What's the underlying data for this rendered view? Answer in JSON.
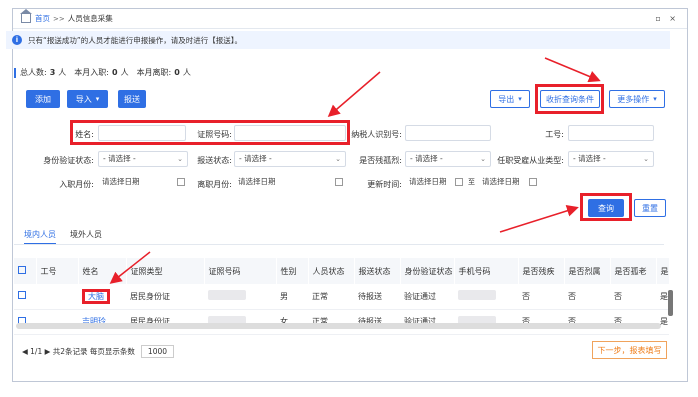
{
  "titlebar": {
    "home": "首页",
    "sep": ">>",
    "current": "人员信息采集",
    "controls": "▫ ×"
  },
  "notice": {
    "icon": "i",
    "text": "只有“报送成功”的人员才能进行申报操作，请及时进行【报送】。"
  },
  "stats": {
    "total_label": "总人数:",
    "total": "3",
    "unit1": "人",
    "hired_label": "本月入职:",
    "hired": "0",
    "unit2": "人",
    "left_label": "本月离职:",
    "left": "0",
    "unit3": "人"
  },
  "toolbar": {
    "add": "添加",
    "import": "导入",
    "report": "报送",
    "export": "导出",
    "collapse": "收折查询条件",
    "more": "更多操作"
  },
  "filters": {
    "name_label": "姓名:",
    "name_value": "",
    "idno_label": "证照号码:",
    "idno_value": "",
    "taxid_label": "纳税人识别号:",
    "taxid_value": "",
    "empno_label": "工号:",
    "empno_value": "",
    "idverify_label": "身份验证状态:",
    "idverify_value": "- 请选择 -",
    "report_label": "报送状态:",
    "report_value": "- 请选择 -",
    "disabled_label": "是否残孤烈:",
    "disabled_value": "- 请选择 -",
    "industry_label": "任职受雇从业类型:",
    "industry_value": "- 请选择 -",
    "entry_label": "入职月份:",
    "entry_value": "请选择日期",
    "leave_label": "离职月份:",
    "leave_value": "请选择日期",
    "update_label": "更新时间:",
    "update_from": "请选择日期",
    "update_to_sep": "至",
    "update_to": "请选择日期"
  },
  "actions": {
    "query": "查询",
    "reset": "重置"
  },
  "tabs": [
    "境内人员",
    "境外人员"
  ],
  "table": {
    "headers": [
      "工号",
      "姓名",
      "证照类型",
      "证照号码",
      "性别",
      "人员状态",
      "报送状态",
      "身份验证状态",
      "手机号码",
      "是否残疾",
      "是否烈属",
      "是否孤老",
      "是"
    ],
    "rows": [
      {
        "id": "",
        "name": "大脑",
        "idtype": "居民身份证",
        "gender": "男",
        "status": "正常",
        "report": "待报送",
        "verify": "验证通过",
        "disabled": "否",
        "martyr": "否",
        "orphan": "否",
        "extra": "是"
      },
      {
        "id": "",
        "name": "吉明玲",
        "idtype": "居民身份证",
        "gender": "女",
        "status": "正常",
        "report": "待报送",
        "verify": "验证通过",
        "disabled": "否",
        "martyr": "否",
        "orphan": "否",
        "extra": "是"
      }
    ]
  },
  "pager": {
    "info": "◀ 1/1 ▶ 共2条记录  每页显示条数",
    "size": "1000"
  },
  "next_step": "下一步，报表填写",
  "colors": {
    "accent": "#2f6fe4",
    "highlight": "#e8202a",
    "orange": "#ef7d1a"
  }
}
